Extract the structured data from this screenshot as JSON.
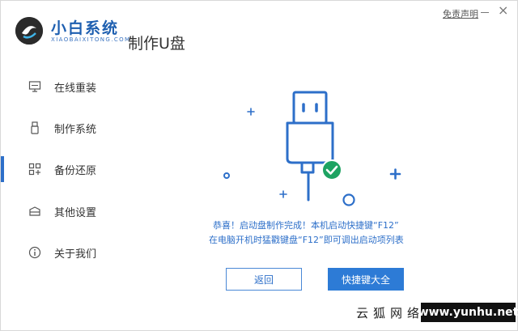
{
  "header": {
    "app_name": "小白系统",
    "app_sub": "XIAOBAIXITONG.COM",
    "page_title": "制作U盘",
    "disclaimer": "免责声明",
    "close": "×"
  },
  "sidebar": {
    "items": [
      {
        "label": "在线重装",
        "icon": "monitor-icon"
      },
      {
        "label": "制作系统",
        "icon": "usb-icon"
      },
      {
        "label": "备份还原",
        "icon": "backup-icon",
        "active": true
      },
      {
        "label": "其他设置",
        "icon": "box-icon"
      },
      {
        "label": "关于我们",
        "icon": "info-icon"
      }
    ]
  },
  "main": {
    "message_line1": "恭喜！启动盘制作完成！本机启动快捷键“F12”",
    "message_line2": "在电脑开机时猛戳键盘“F12”即可调出启动项列表",
    "back_button": "返回",
    "shortcut_button": "快捷键大全"
  },
  "watermark": {
    "left": "云狐网络",
    "right": "www.yunhu.net"
  },
  "colors": {
    "accent": "#2d6fc9",
    "success": "#1ea362",
    "brand": "#1e5fb0"
  }
}
